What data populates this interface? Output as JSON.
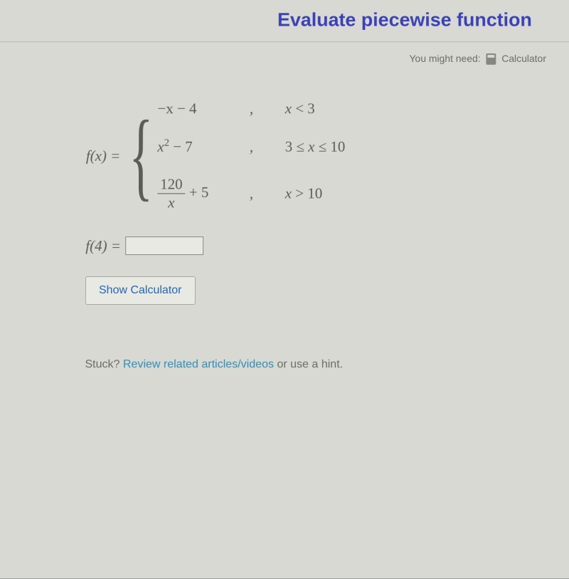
{
  "header": {
    "title": "Evaluate piecewise function"
  },
  "tools": {
    "label": "You might need:",
    "calculator": "Calculator"
  },
  "function": {
    "label": "f(x) =",
    "pieces": [
      {
        "expr": "−x − 4",
        "comma": ",",
        "cond": "x < 3"
      },
      {
        "expr_base": "x",
        "expr_sup": "2",
        "expr_rest": " − 7",
        "comma": ",",
        "cond": "3 ≤ x ≤ 10"
      },
      {
        "frac_num": "120",
        "frac_den": "x",
        "expr_rest": " + 5",
        "comma": ",",
        "cond": "x > 10"
      }
    ]
  },
  "answer": {
    "label": "f(4) =",
    "value": ""
  },
  "buttons": {
    "show_calculator": "Show Calculator"
  },
  "stuck": {
    "prefix": "Stuck? ",
    "link": "Review related articles/videos",
    "suffix": " or use a hint."
  }
}
